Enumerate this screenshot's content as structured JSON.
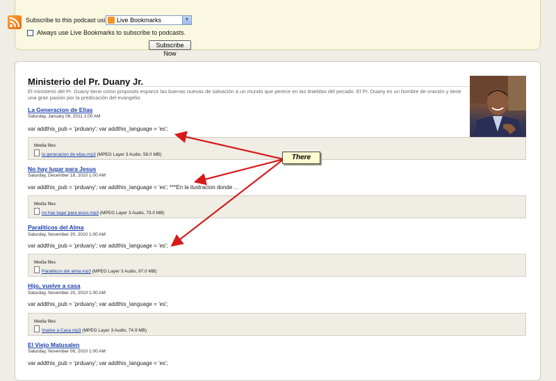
{
  "subscribe": {
    "label": "Subscribe to this podcast using",
    "selected": "Live Bookmarks",
    "checkbox_label": "Always use Live Bookmarks to subscribe to podcasts.",
    "button": "Subscribe Now"
  },
  "page": {
    "title": "Ministerio del Pr. Duany Jr.",
    "description": "El ministerio del Pr. Duany tiene como proposito esparcir las buenas nuevas de salvación a un mundo que perece en las tinieblas del pecado. El Pr. Duany es un hombre de oración y tiene una gran pasión por la predicación del evangelio."
  },
  "media_label": "Media files",
  "episodes": [
    {
      "title": "La Generacion de Elias",
      "date": "Saturday, January 08, 2011 1:00 AM",
      "code": "var addthis_pub = 'prduany'; var addthis_language = 'es';",
      "file": "la generacion de elias.mp3",
      "file_info": "(MPEG Layer 3 Audio, 58.0 MB)"
    },
    {
      "title": "No hay lugar para Jesus",
      "date": "Saturday, December 18, 2010 1:00 AM",
      "code": "var addthis_pub = 'prduany'; var addthis_language = 'es';   ***En la ilustracion donde ...",
      "file": "no hay lugar para jesus.mp3",
      "file_info": "(MPEG Layer 3 Audio, 73.0 MB)"
    },
    {
      "title": "Paraliticos del Alma",
      "date": "Saturday, November 20, 2010 1:00 AM",
      "code": "var addthis_pub = 'prduany'; var addthis_language = 'es';",
      "file": "Paraliticos del alma.mp3",
      "file_info": "(MPEG Layer 3 Audio, 97.0 MB)"
    },
    {
      "title": "Hijo, vuelve a casa",
      "date": "Saturday, November 20, 2010 1:00 AM",
      "code": "var addthis_pub = 'prduany'; var addthis_language = 'es';",
      "file": "Vuelve a Casa.mp3",
      "file_info": "(MPEG Layer 3 Audio, 74.9 MB)"
    },
    {
      "title": "El Viejo Matusalen",
      "date": "Saturday, November 06, 2010 1:00 AM",
      "code": "var addthis_pub = 'prduany'; var addthis_language = 'es';"
    }
  ],
  "annotation": {
    "text": "There",
    "color": "#d61a1a"
  }
}
